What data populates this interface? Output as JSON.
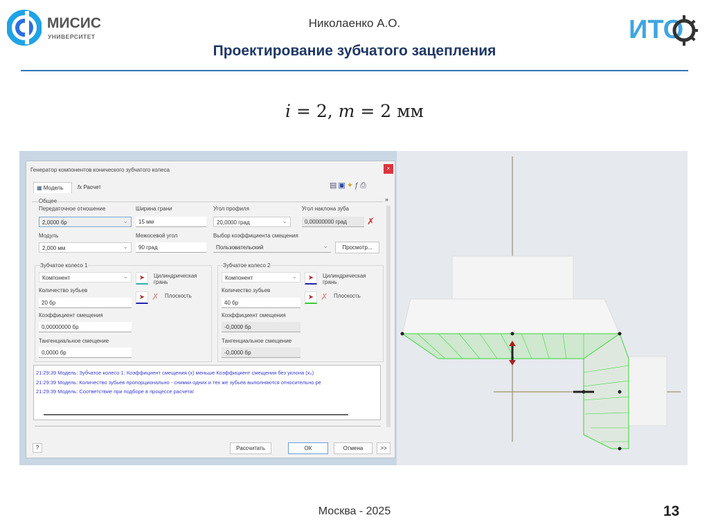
{
  "header": {
    "university_logo_text": "МИСИС",
    "university_logo_sub": "УНИВЕРСИТЕТ",
    "institute_logo_text": "ИТО",
    "author": "Николаенко А.О.",
    "title": "Проектирование зубчатого зацепления"
  },
  "formula": {
    "i_sym": "i",
    "i_val": " = 2, ",
    "m_sym": "m",
    "m_val": " = 2 мм"
  },
  "dialog": {
    "title": "Генератор компонентов конического зубчатого колеса",
    "tabs": [
      {
        "label": "Модель"
      },
      {
        "label": "Расчет"
      }
    ],
    "general": {
      "group": "Общее",
      "ratio_label": "Передаточное отношение",
      "ratio_value": "2,0000 бр",
      "face_label": "Ширина грани",
      "face_value": "15 мм",
      "profile_label": "Угол профиля",
      "profile_value": "20,0000 град",
      "helix_label": "Угол наклона зуба",
      "helix_value": "0,00000000 град",
      "module_label": "Модуль",
      "module_value": "2,000 мм",
      "shaft_label": "Межосевой угол",
      "shaft_value": "90 град",
      "coef_label": "Выбор коэффициента смещения",
      "coef_value": "Пользовательский",
      "preview_button": "Просмотр..."
    },
    "gear1": {
      "group": "Зубчатое колесо 1",
      "type": "Компонент",
      "cyl": "Цилиндрическая грань",
      "plane": "Плоскость",
      "teeth_label": "Количество зубьев",
      "teeth": "20 бр",
      "shift_label": "Коэффициент смещения",
      "shift": "0,00000000 бр",
      "tang_label": "Тангенциальное смещение",
      "tang": "0,0000 бр"
    },
    "gear2": {
      "group": "Зубчатое колесо 2",
      "type": "Компонент",
      "cyl": "Цилиндрическая грань",
      "plane": "Плоскость",
      "teeth_label": "Количество зубьев",
      "teeth": "40 бр",
      "shift_label": "Коэффициент смещения",
      "shift": "-0,0000 бр",
      "tang_label": "Тангенциальное смещение",
      "tang": "-0,0000 бр"
    },
    "log": [
      "21:29:39 Модель: Зубчатое колесо 1: Коэффициент смещения (x) меньше Коэффициент смещения без уклона (x₀)",
      "21:29:39 Модель: Количество зубьев пропорционально - снимки одних и тех же зубьев выполняются относительно ре",
      "21:29:39 Модель: Соответствие при подборе в процессе расчета!"
    ],
    "buttons": {
      "calculate": "Рассчитать",
      "ok": "ОК",
      "cancel": "Отмена",
      "more": ">>",
      "help": "?"
    }
  },
  "footer": {
    "city_year": "Москва - 2025",
    "page": "13"
  },
  "colors": {
    "title": "#1f3864",
    "rule": "#2e75b6",
    "log_text": "#3a3ad0",
    "wireframe": "#38d838"
  }
}
